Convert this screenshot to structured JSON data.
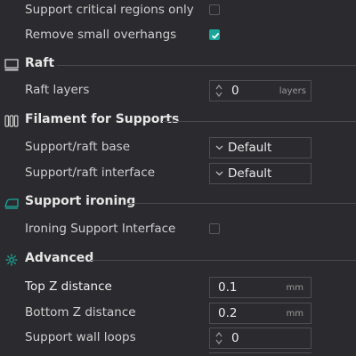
{
  "rows": {
    "support_critical_regions_only": {
      "label": "Support critical regions only",
      "checked": false
    },
    "remove_small_overhangs": {
      "label": "Remove small overhangs",
      "checked": true
    }
  },
  "raft": {
    "title": "Raft",
    "icon": "raft-icon",
    "raft_layers": {
      "label": "Raft layers",
      "value": "0",
      "unit": "layers"
    }
  },
  "filament": {
    "title": "Filament for Supports",
    "icon": "filament-icon",
    "base": {
      "label": "Support/raft base",
      "value": "Default"
    },
    "interface": {
      "label": "Support/raft interface",
      "value": "Default"
    }
  },
  "ironing": {
    "title": "Support ironing",
    "icon": "iron-icon",
    "ironing_interface": {
      "label": "Ironing Support Interface",
      "checked": false
    }
  },
  "advanced": {
    "title": "Advanced",
    "icon": "advanced-icon",
    "top_z": {
      "label": "Top Z distance",
      "value": "0.1",
      "unit": "mm"
    },
    "bottom_z": {
      "label": "Bottom Z distance",
      "value": "0.2",
      "unit": "mm"
    },
    "wall_loops": {
      "label": "Support wall loops",
      "value": "0"
    }
  },
  "colors": {
    "background": "#2b2b2f",
    "accent": "#1aa79b",
    "border": "#4d4d52"
  }
}
